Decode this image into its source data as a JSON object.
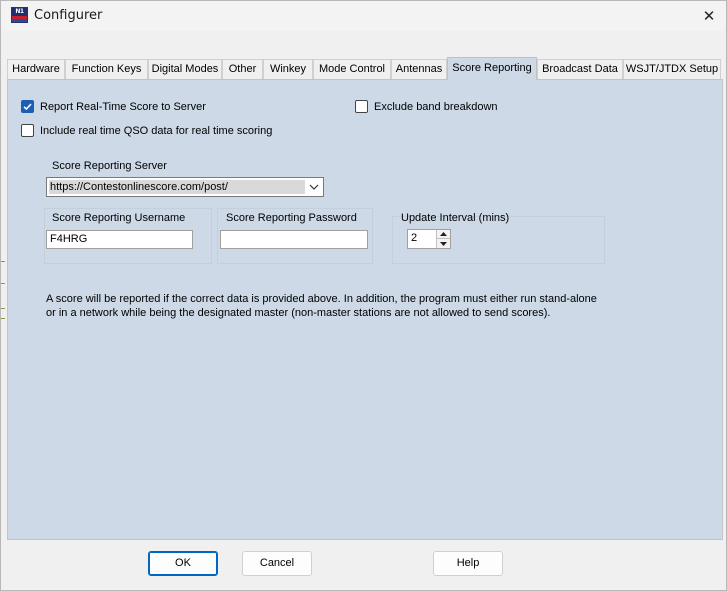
{
  "window": {
    "title": "Configurer",
    "close_glyph": "✕"
  },
  "tabs": [
    {
      "label": "Hardware",
      "active": false
    },
    {
      "label": "Function Keys",
      "active": false
    },
    {
      "label": "Digital Modes",
      "active": false
    },
    {
      "label": "Other",
      "active": false
    },
    {
      "label": "Winkey",
      "active": false
    },
    {
      "label": "Mode Control",
      "active": false
    },
    {
      "label": "Antennas",
      "active": false
    },
    {
      "label": "Score Reporting",
      "active": true
    },
    {
      "label": "Broadcast Data",
      "active": false
    },
    {
      "label": "WSJT/JTDX Setup",
      "active": false
    }
  ],
  "score_reporting": {
    "report_realtime": {
      "label": "Report Real-Time Score to Server",
      "checked": true
    },
    "exclude_band": {
      "label": "Exclude band breakdown",
      "checked": false
    },
    "include_qso": {
      "label": "Include real time QSO data for real time scoring",
      "checked": false
    },
    "server_label": "Score Reporting Server",
    "server_value": "https://Contestonlinescore.com/post/",
    "username_label": "Score Reporting Username",
    "username_value": "F4HRG",
    "password_label": "Score Reporting Password",
    "password_value": "",
    "interval_label": "Update Interval (mins)",
    "interval_value": "2",
    "info_text": "A score will be reported if the correct data is provided above. In addition, the program must either run stand-alone or in a network while being the designated master (non-master stations are not allowed to send scores)."
  },
  "buttons": {
    "ok": "OK",
    "cancel": "Cancel",
    "help": "Help"
  },
  "colors": {
    "panel_bg": "#cdd9e7",
    "checkbox_accent": "#1a5fb4",
    "default_button_border": "#0067c0"
  }
}
